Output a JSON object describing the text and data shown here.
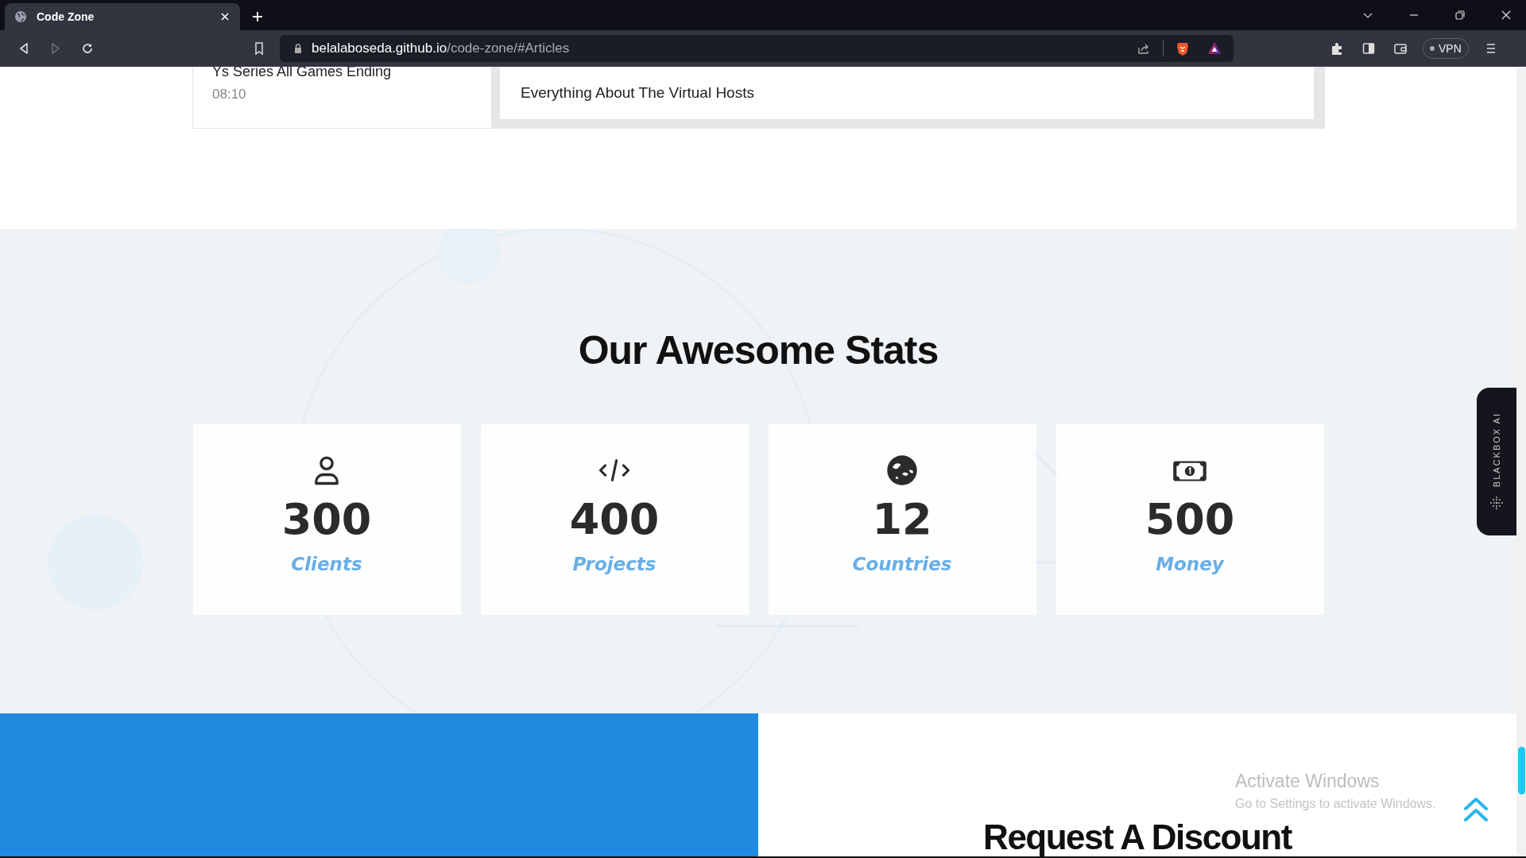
{
  "browser": {
    "tab": {
      "title": "Code Zone"
    },
    "url": {
      "host": "belalaboseda.github.io",
      "path": "/code-zone/#Articles"
    },
    "vpn": "VPN"
  },
  "articles": {
    "item": {
      "title": "Ys Series All Games Ending",
      "time": "08:10"
    },
    "featured": {
      "title": "Everything About The Virtual Hosts"
    }
  },
  "stats": {
    "title": "Our Awesome Stats",
    "items": [
      {
        "kind": "user",
        "number": "300",
        "label": "Clients"
      },
      {
        "kind": "code",
        "number": "400",
        "label": "Projects"
      },
      {
        "kind": "globe",
        "number": "12",
        "label": "Countries"
      },
      {
        "kind": "money",
        "number": "500",
        "label": "Money"
      }
    ]
  },
  "discount": {
    "title": "Request A Discount"
  },
  "blackbox": {
    "label": "BLACKBOX AI"
  },
  "os_notice": {
    "title": "Activate Windows",
    "message": "Go to Settings to activate Windows."
  }
}
